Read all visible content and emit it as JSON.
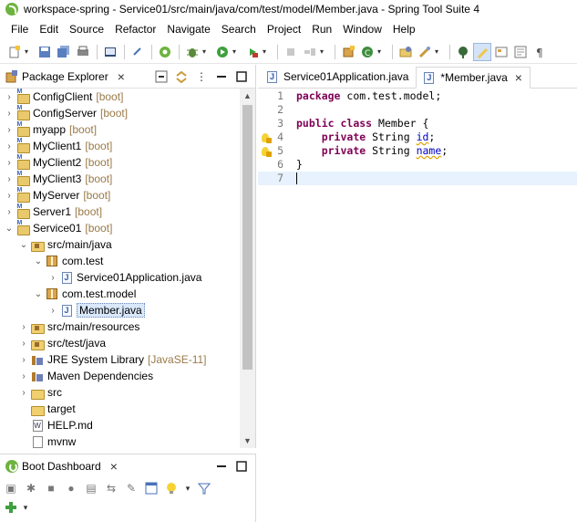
{
  "window": {
    "title": "workspace-spring - Service01/src/main/java/com/test/model/Member.java - Spring Tool Suite 4"
  },
  "menu": [
    "File",
    "Edit",
    "Source",
    "Refactor",
    "Navigate",
    "Search",
    "Project",
    "Run",
    "Window",
    "Help"
  ],
  "package_explorer": {
    "title": "Package Explorer",
    "items": [
      {
        "label": "ConfigClient",
        "tag": "[boot]"
      },
      {
        "label": "ConfigServer",
        "tag": "[boot]"
      },
      {
        "label": "myapp",
        "tag": "[boot]"
      },
      {
        "label": "MyClient1",
        "tag": "[boot]"
      },
      {
        "label": "MyClient2",
        "tag": "[boot]"
      },
      {
        "label": "MyClient3",
        "tag": "[boot]"
      },
      {
        "label": "MyServer",
        "tag": "[boot]"
      },
      {
        "label": "Server1",
        "tag": "[boot]"
      },
      {
        "label": "Service01",
        "tag": "[boot]"
      },
      {
        "label": "src/main/java"
      },
      {
        "label": "com.test"
      },
      {
        "label": "Service01Application.java"
      },
      {
        "label": "com.test.model"
      },
      {
        "label": "Member.java"
      },
      {
        "label": "src/main/resources"
      },
      {
        "label": "src/test/java"
      },
      {
        "label": "JRE System Library",
        "tag": "[JavaSE-11]"
      },
      {
        "label": "Maven Dependencies"
      },
      {
        "label": "src"
      },
      {
        "label": "target"
      },
      {
        "label": "HELP.md"
      },
      {
        "label": "mvnw"
      }
    ]
  },
  "boot_dashboard": {
    "title": "Boot Dashboard"
  },
  "editor": {
    "tabs": [
      {
        "label": "Service01Application.java"
      },
      {
        "label": "*Member.java"
      }
    ],
    "lines": [
      {
        "num": "1"
      },
      {
        "num": "2"
      },
      {
        "num": "3"
      },
      {
        "num": "4"
      },
      {
        "num": "5"
      },
      {
        "num": "6"
      },
      {
        "num": "7"
      }
    ],
    "code": {
      "l1_kw": "package",
      "l1_rest": " com.test.model;",
      "l3_kw1": "public",
      "l3_kw2": "class",
      "l3_rest": " Member {",
      "l4_kw": "private",
      "l4_type": " String ",
      "l4_field": "id",
      "l4_end": ";",
      "l5_kw": "private",
      "l5_type": " String ",
      "l5_field": "name",
      "l5_end": ";",
      "l6": "}"
    }
  }
}
